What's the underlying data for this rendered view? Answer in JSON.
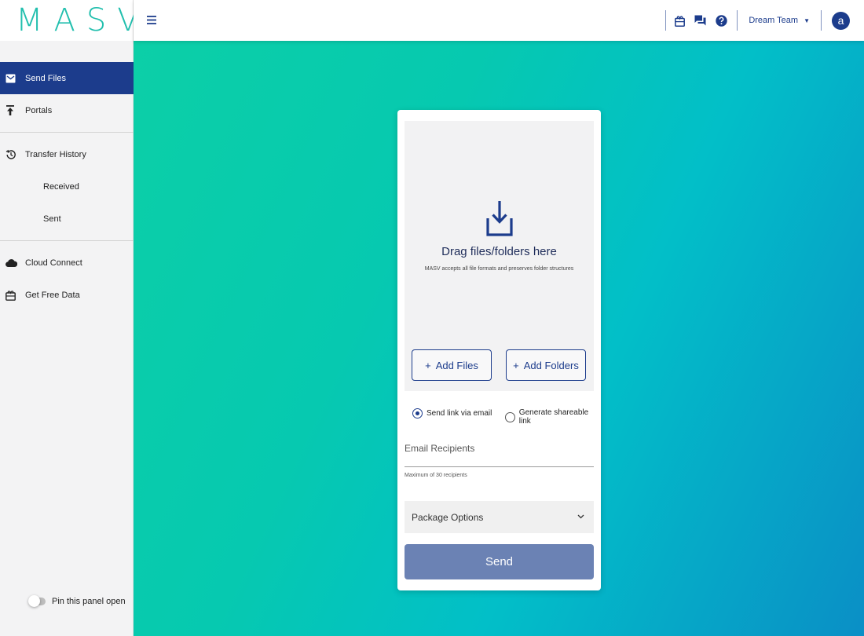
{
  "logo": {
    "text": "MASV"
  },
  "sidebar": {
    "items": [
      {
        "label": "Send Files",
        "icon": "envelope-icon",
        "active": true
      },
      {
        "label": "Portals",
        "icon": "upload-icon"
      },
      {
        "label": "Transfer History",
        "icon": "history-icon"
      },
      {
        "label": "Received"
      },
      {
        "label": "Sent"
      },
      {
        "label": "Cloud Connect",
        "icon": "cloud-icon"
      },
      {
        "label": "Get Free Data",
        "icon": "gift-icon"
      }
    ],
    "pin_label": "Pin this panel open"
  },
  "topbar": {
    "menu_icon": "hamburger-icon",
    "team_name": "Dream Team",
    "avatar_letter": "a",
    "icons": [
      "gift-icon",
      "chat-icon",
      "help-icon"
    ]
  },
  "upload": {
    "drop_title": "Drag files/folders here",
    "drop_subtitle": "MASV accepts all file formats and preserves folder structures",
    "add_files_label": "Add Files",
    "add_folders_label": "Add Folders",
    "plus": "+",
    "radio_email": "Send link via email",
    "radio_link": "Generate shareable link",
    "selected_option": "Send link via email",
    "email_placeholder": "Email Recipients",
    "email_hint": "Maximum of 30 recipients",
    "package_options_label": "Package Options",
    "send_label": "Send"
  },
  "colors": {
    "brand_navy": "#1c3c8c",
    "logo_teal": "#22bfae",
    "send_button": "#6b82b4",
    "gradient_start": "#0ccfa7",
    "gradient_end": "#0a8fc6"
  }
}
